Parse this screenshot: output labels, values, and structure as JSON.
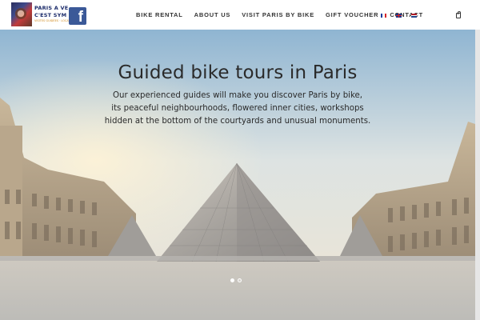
{
  "header": {
    "logo": {
      "line1": "PARIS A VE",
      "line2": "C'EST SYM",
      "line3": "VISITES GUIDÉES · LOCATION VÉLO"
    },
    "nav": [
      {
        "label": "BIKE RENTAL"
      },
      {
        "label": "ABOUT US"
      },
      {
        "label": "VISIT PARIS BY BIKE"
      },
      {
        "label": "GIFT VOUCHER"
      },
      {
        "label": "CONTACT"
      }
    ],
    "languages": [
      "fr",
      "en",
      "nl"
    ]
  },
  "hero": {
    "title": "Guided bike tours in Paris",
    "text": [
      "Our experienced guides will make you discover Paris by bike,",
      "its peaceful neighbourhoods, flowered inner cities, workshops",
      "hidden at the bottom of the courtyards and unusual monuments."
    ],
    "slides": 2,
    "active_slide": 1
  },
  "colors": {
    "brand": "#1c2c6b",
    "facebook": "#3b5998",
    "nav_text": "#333333"
  }
}
